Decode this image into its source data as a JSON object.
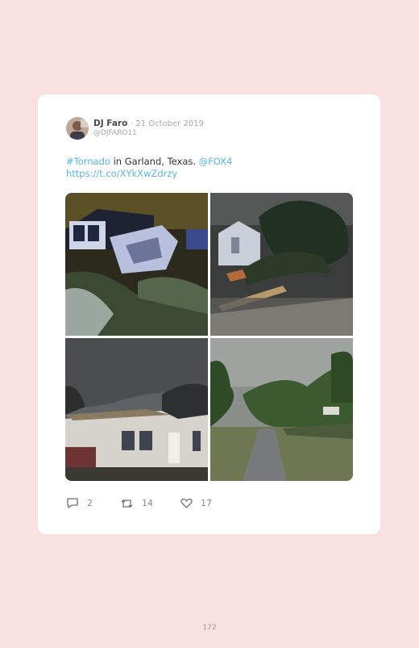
{
  "tweet": {
    "author_name": "DJ Faro",
    "date": "· 21 October 2019",
    "handle": "@DJFARO11",
    "text_hashtag": "#Tornado",
    "text_body": " in Garland, Texas. ",
    "text_mention": "@FOX4",
    "text_url": "https://t.co/XYkXwZdrzy",
    "photos": [
      {
        "icon": "photo-damaged-car-night"
      },
      {
        "icon": "photo-fallen-tree-house"
      },
      {
        "icon": "photo-roofless-house"
      },
      {
        "icon": "photo-fallen-tree-sidewalk"
      }
    ],
    "replies": "2",
    "retweets": "14",
    "likes": "17"
  },
  "page": {
    "number": "172"
  },
  "colors": {
    "background": "#f9e1e2",
    "card": "#ffffff",
    "link": "#56b4e8"
  }
}
